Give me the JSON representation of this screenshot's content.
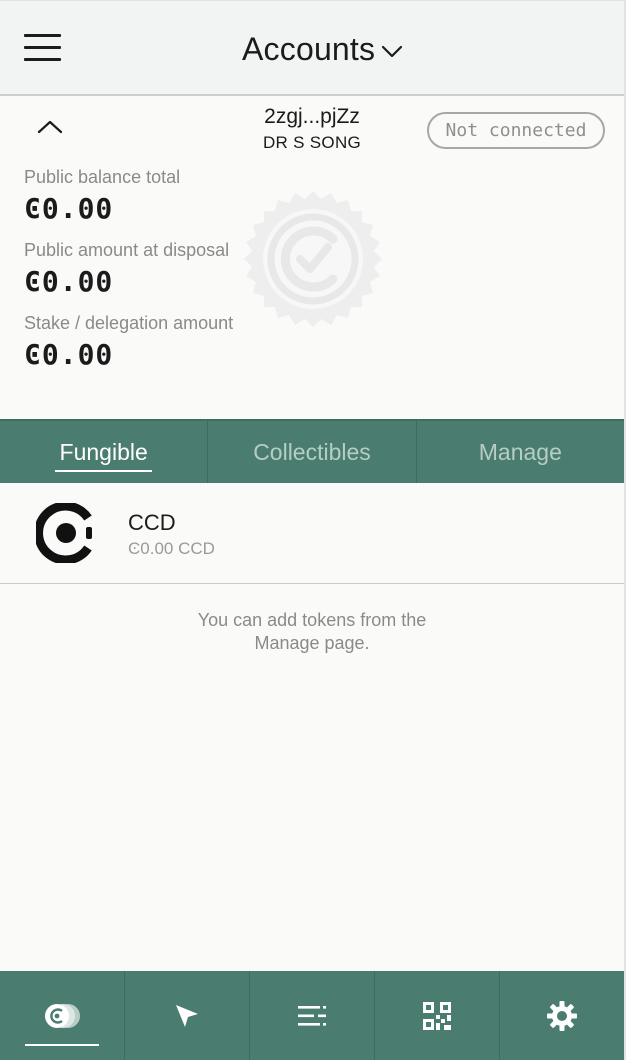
{
  "header": {
    "title": "Accounts",
    "menu_icon": "hamburger-menu-icon",
    "dropdown_icon": "chevron-down-icon"
  },
  "account": {
    "address_short": "2zgj...pjZz",
    "name": "DR S SONG",
    "connection_status": "Not connected",
    "collapse_icon": "chevron-up-icon",
    "watermark_icon": "verified-seal-icon",
    "balances": [
      {
        "label": "Public balance total",
        "value": "Ͼ0.00"
      },
      {
        "label": "Public amount at disposal",
        "value": "Ͼ0.00"
      },
      {
        "label": "Stake / delegation amount",
        "value": "Ͼ0.00"
      }
    ]
  },
  "tabs": [
    {
      "label": "Fungible",
      "active": true
    },
    {
      "label": "Collectibles",
      "active": false
    },
    {
      "label": "Manage",
      "active": false
    }
  ],
  "tokens": [
    {
      "name": "CCD",
      "balance": "Ͼ0.00 CCD",
      "icon": "concordium-logo-icon"
    }
  ],
  "hint": {
    "line1": "You can add tokens from the",
    "line2": "Manage page."
  },
  "bottom_nav": [
    {
      "icon": "ccd-coins-icon",
      "active": true
    },
    {
      "icon": "send-arrow-icon",
      "active": false
    },
    {
      "icon": "transaction-list-icon",
      "active": false
    },
    {
      "icon": "qr-code-icon",
      "active": false
    },
    {
      "icon": "settings-gear-icon",
      "active": false
    }
  ],
  "colors": {
    "accent": "#4a7d70",
    "tab_inactive_text": "#b6cdc6",
    "muted_text": "#8a8a8a"
  }
}
